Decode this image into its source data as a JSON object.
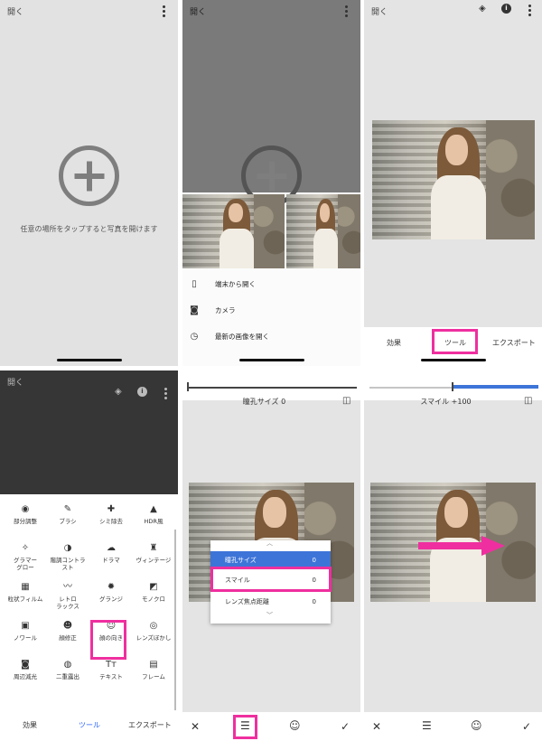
{
  "panel1": {
    "open_label": "開く",
    "hint": "任意の場所をタップすると写真を開けます"
  },
  "panel2": {
    "open_label": "開く",
    "menu": [
      {
        "icon": "phone-icon",
        "label": "端末から開く"
      },
      {
        "icon": "camera-icon",
        "label": "カメラ"
      },
      {
        "icon": "clock-icon",
        "label": "最新の画像を開く"
      }
    ]
  },
  "panel3": {
    "open_label": "開く",
    "tabs": [
      "効果",
      "ツール",
      "エクスポート"
    ]
  },
  "panel4": {
    "open_label": "開く",
    "tools": [
      {
        "label": "部分調整",
        "icon": "target-icon"
      },
      {
        "label": "ブラシ",
        "icon": "brush-icon"
      },
      {
        "label": "シミ除去",
        "icon": "bandage-icon"
      },
      {
        "label": "HDR風",
        "icon": "mountain-icon"
      },
      {
        "label": "グラマー\nグロー",
        "icon": "glamour-glow-icon"
      },
      {
        "label": "階調コントラ\nスト",
        "icon": "contrast-icon"
      },
      {
        "label": "ドラマ",
        "icon": "cloud-icon"
      },
      {
        "label": "ヴィンテージ",
        "icon": "lamp-icon"
      },
      {
        "label": "粒状フィルム",
        "icon": "grain-icon"
      },
      {
        "label": "レトロ\nラックス",
        "icon": "mustache-icon"
      },
      {
        "label": "グランジ",
        "icon": "grunge-icon"
      },
      {
        "label": "モノクロ",
        "icon": "mono-icon"
      },
      {
        "label": "ノワール",
        "icon": "film-icon"
      },
      {
        "label": "顔修正",
        "icon": "face-smile-icon"
      },
      {
        "label": "顔の向き",
        "icon": "face-pose-icon"
      },
      {
        "label": "レンズぼかし",
        "icon": "lens-blur-icon"
      },
      {
        "label": "周辺減光",
        "icon": "vignette-icon"
      },
      {
        "label": "二重露出",
        "icon": "double-exposure-icon"
      },
      {
        "label": "テキスト",
        "icon": "text-icon"
      },
      {
        "label": "フレーム",
        "icon": "frame-icon"
      }
    ],
    "tabs": [
      "効果",
      "ツール",
      "エクスポート"
    ]
  },
  "panel5": {
    "caption": "瞳孔サイズ 0",
    "dropdown": [
      {
        "label": "瞳孔サイズ",
        "value": "0"
      },
      {
        "label": "スマイル",
        "value": "0"
      },
      {
        "label": "レンズ焦点距離",
        "value": "0"
      }
    ]
  },
  "panel6": {
    "caption": "スマイル +100"
  },
  "colors": {
    "accent": "#2962ff",
    "highlight": "#ef2f9f",
    "dropdown_selected": "#3d74d8"
  }
}
